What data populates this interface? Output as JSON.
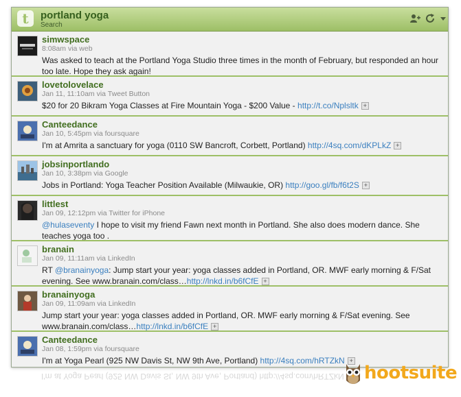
{
  "column": {
    "title": "portland yoga",
    "subtitle": "Search"
  },
  "header_icons": [
    "add-user-icon",
    "refresh-icon",
    "dropdown-arrow-icon"
  ],
  "tweets": [
    {
      "user": "simwspace",
      "meta": "8:08am via web",
      "text": "Was asked to teach at the Portland Yoga Studio three times in the month of February, but responded an hour too late. Hope they ask again!",
      "link": "",
      "expand": false
    },
    {
      "user": "lovetolovelace",
      "meta": "Jan 11, 11:10am via Tweet Button",
      "text": "$20 for 20 Bikram Yoga Classes at Fire Mountain Yoga - $200 Value - ",
      "link": "http://t.co/Nplsltk",
      "expand": true
    },
    {
      "user": "Canteedance",
      "meta": "Jan 10, 5:45pm via foursquare",
      "text": "I'm at Amrita a sanctuary for yoga (0110 SW Bancroft, Corbett, Portland) ",
      "link": "http://4sq.com/dKPLkZ",
      "expand": true
    },
    {
      "user": "jobsinportlando",
      "meta": "Jan 10, 3:38pm via Google",
      "text": "Jobs in Portland: Yoga Teacher Position Available (Milwaukie, OR) ",
      "link": "http://goo.gl/fb/f6t2S",
      "expand": true
    },
    {
      "user": "littlest",
      "meta": "Jan 09, 12:12pm via Twitter for iPhone",
      "mention": "@hulaseventy",
      "text": " I hope to visit my friend Fawn next month in Portland. She also does modern dance. She teaches yoga too .",
      "expand": false
    },
    {
      "user": "branain",
      "meta": "Jan 09, 11:11am via LinkedIn",
      "prefix": "RT ",
      "mention": "@branainyoga",
      "text": ": Jump start your year: yoga classes added in Portland, OR. MWF early morning & F/Sat evening. See www.branain.com/class…",
      "link": "http://lnkd.in/b6fCfE",
      "expand": true
    },
    {
      "user": "branainyoga",
      "meta": "Jan 09, 11:09am via LinkedIn",
      "text": "Jump start your year: yoga classes added in Portland, OR. MWF early morning & F/Sat evening. See www.branain.com/class…",
      "link": "http://lnkd.in/b6fCfE",
      "expand": true
    },
    {
      "user": "Canteedance",
      "meta": "Jan 08, 1:59pm via foursquare",
      "text": "I'm at Yoga Pearl (925 NW Davis St, NW 9th Ave, Portland) ",
      "link": "http://4sq.com/hRTZkN",
      "expand": true
    }
  ],
  "brand": {
    "name": "hootsuite",
    "colors": {
      "header_green": "#9dbf66",
      "username_green": "#416e1f",
      "link_blue": "#3a7fbf",
      "brand_orange": "#f2a81c"
    }
  }
}
